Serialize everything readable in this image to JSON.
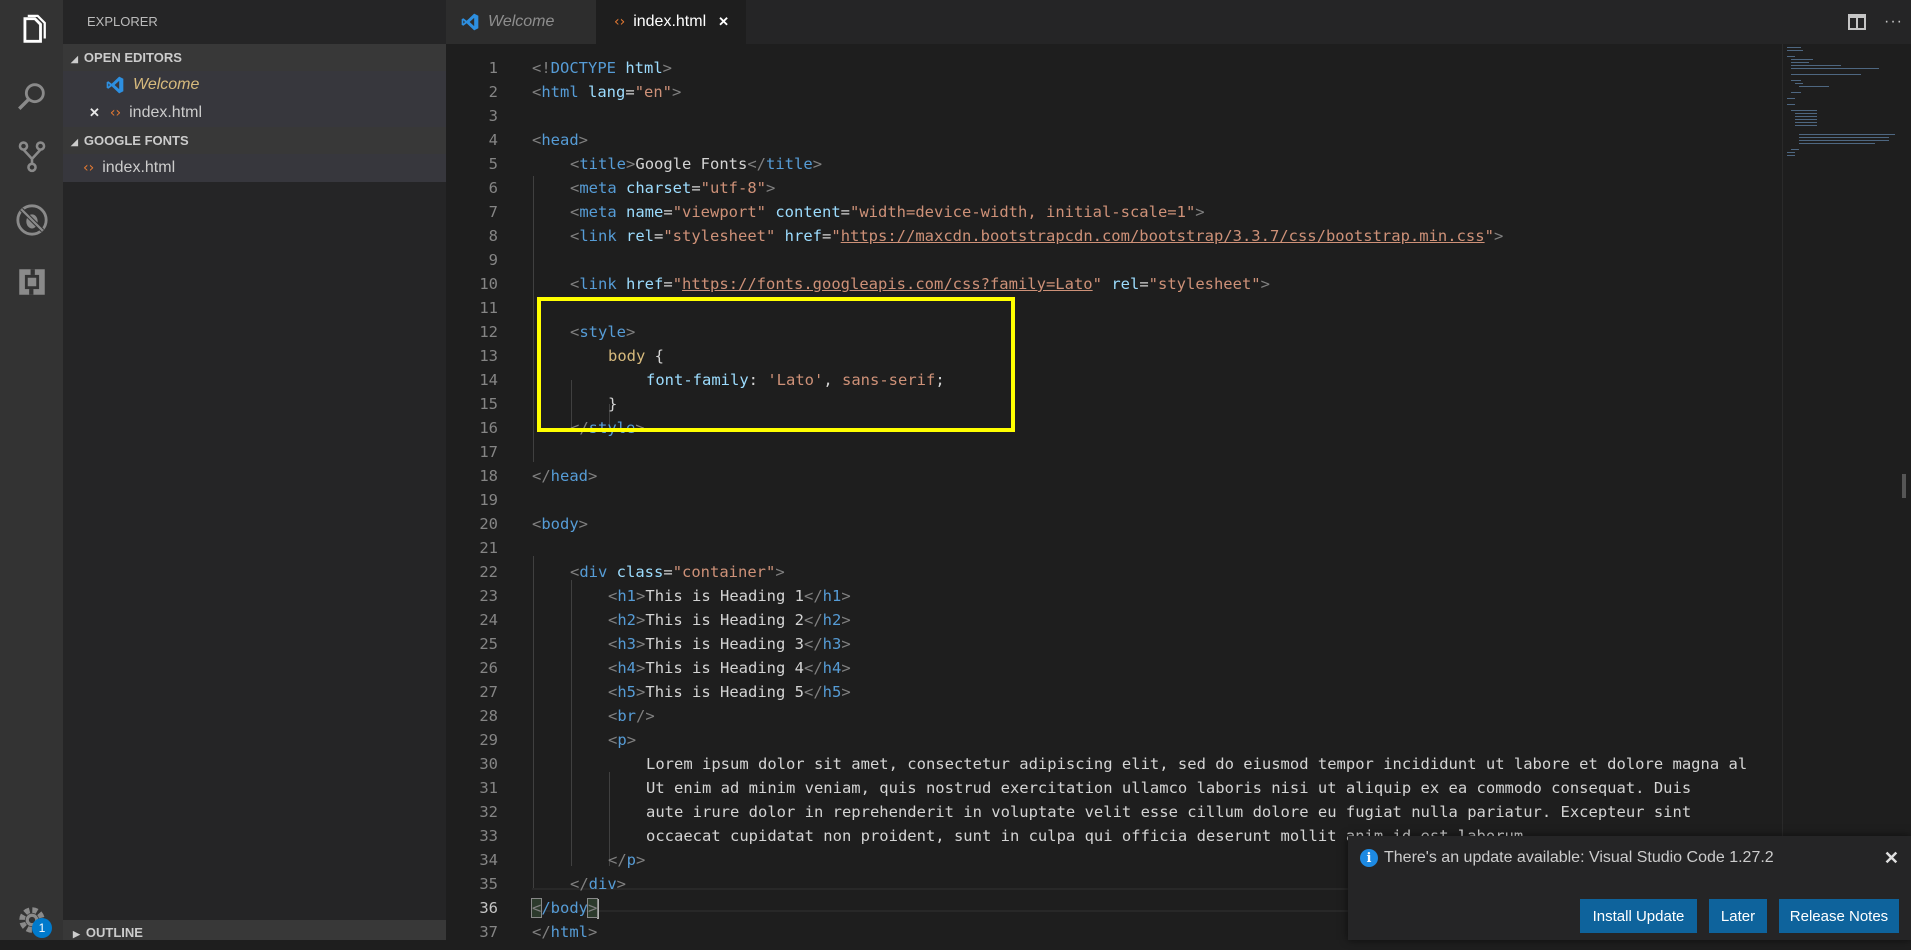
{
  "activity_bar": {
    "items": [
      {
        "name": "explorer",
        "icon": "files-icon"
      },
      {
        "name": "search",
        "icon": "search-icon"
      },
      {
        "name": "source-control",
        "icon": "source-control-icon"
      },
      {
        "name": "debug",
        "icon": "debug-icon"
      },
      {
        "name": "extensions",
        "icon": "extensions-icon"
      }
    ],
    "settings_badge": "1"
  },
  "sidebar": {
    "title": "EXPLORER",
    "sections": [
      {
        "label": "OPEN EDITORS",
        "items": [
          {
            "label": "Welcome",
            "icon": "vscode-icon",
            "italic": true
          },
          {
            "label": "index.html",
            "icon": "html-icon",
            "close": "✕"
          }
        ]
      },
      {
        "label": "GOOGLE FONTS",
        "items": [
          {
            "label": "index.html",
            "icon": "html-icon"
          }
        ]
      }
    ],
    "outline_label": "OUTLINE"
  },
  "tabs": [
    {
      "label": "Welcome",
      "icon": "vscode-icon",
      "active": false
    },
    {
      "label": "index.html",
      "icon": "html-icon",
      "active": true,
      "close": "✕"
    }
  ],
  "tab_actions": {
    "split": "split-editor-icon",
    "more": "···"
  },
  "editor": {
    "current_line": 36,
    "line_numbers": [
      "1",
      "2",
      "3",
      "4",
      "5",
      "6",
      "7",
      "8",
      "9",
      "10",
      "11",
      "12",
      "13",
      "14",
      "15",
      "16",
      "17",
      "18",
      "19",
      "20",
      "21",
      "22",
      "23",
      "24",
      "25",
      "26",
      "27",
      "28",
      "29",
      "30",
      "31",
      "32",
      "33",
      "34",
      "35",
      "36",
      "37"
    ],
    "lines": {
      "l1": {
        "a": "<!",
        "b": "DOCTYPE",
        "c": " html",
        "d": ">"
      },
      "l2": {
        "a": "<",
        "b": "html",
        "c": " lang",
        "d": "=",
        "e": "\"en\"",
        "f": ">"
      },
      "l4": {
        "a": "<",
        "b": "head",
        "c": ">"
      },
      "l5": {
        "a": "<",
        "b": "title",
        "c": ">",
        "d": "Google Fonts",
        "e": "</",
        "f": "title",
        "g": ">"
      },
      "l6": {
        "a": "<",
        "b": "meta",
        "c": " charset",
        "d": "=",
        "e": "\"utf-8\"",
        "f": ">"
      },
      "l7": {
        "a": "<",
        "b": "meta",
        "c": " name",
        "d": "=",
        "e": "\"viewport\"",
        "f": " content",
        "g": "=",
        "h": "\"width=device-width, initial-scale=1\"",
        "i": ">"
      },
      "l8": {
        "a": "<",
        "b": "link",
        "c": " rel",
        "d": "=",
        "e": "\"stylesheet\"",
        "f": " href",
        "g": "=",
        "h": "\"",
        "i": "https://maxcdn.bootstrapcdn.com/bootstrap/3.3.7/css/bootstrap.min.css",
        "j": "\"",
        "k": ">"
      },
      "l10": {
        "a": "<",
        "b": "link",
        "c": " href",
        "d": "=",
        "e": "\"",
        "f": "https://fonts.googleapis.com/css?family=Lato",
        "g": "\"",
        "h": " rel",
        "i": "=",
        "j": "\"stylesheet\"",
        "k": ">"
      },
      "l12": {
        "a": "<",
        "b": "style",
        "c": ">"
      },
      "l13": {
        "a": "body",
        "b": " {"
      },
      "l14": {
        "a": "font-family",
        "b": ": ",
        "c": "'Lato'",
        "d": ", ",
        "e": "sans-serif",
        "f": ";"
      },
      "l15": {
        "a": "}"
      },
      "l16": {
        "a": "</",
        "b": "style",
        "c": ">"
      },
      "l18": {
        "a": "</",
        "b": "head",
        "c": ">"
      },
      "l20": {
        "a": "<",
        "b": "body",
        "c": ">"
      },
      "l22": {
        "a": "<",
        "b": "div",
        "c": " class",
        "d": "=",
        "e": "\"container\"",
        "f": ">"
      },
      "l23": {
        "a": "<",
        "b": "h1",
        "c": ">",
        "d": "This is Heading 1",
        "e": "</",
        "f": "h1",
        "g": ">"
      },
      "l24": {
        "a": "<",
        "b": "h2",
        "c": ">",
        "d": "This is Heading 2",
        "e": "</",
        "f": "h2",
        "g": ">"
      },
      "l25": {
        "a": "<",
        "b": "h3",
        "c": ">",
        "d": "This is Heading 3",
        "e": "</",
        "f": "h3",
        "g": ">"
      },
      "l26": {
        "a": "<",
        "b": "h4",
        "c": ">",
        "d": "This is Heading 4",
        "e": "</",
        "f": "h4",
        "g": ">"
      },
      "l27": {
        "a": "<",
        "b": "h5",
        "c": ">",
        "d": "This is Heading 5",
        "e": "</",
        "f": "h5",
        "g": ">"
      },
      "l28": {
        "a": "<",
        "b": "br",
        "c": "/>"
      },
      "l29": {
        "a": "<",
        "b": "p",
        "c": ">"
      },
      "l30": "Lorem ipsum dolor sit amet, consectetur adipiscing elit, sed do eiusmod tempor incididunt ut labore et dolore magna al",
      "l31": "Ut enim ad minim veniam, quis nostrud exercitation ullamco laboris nisi ut aliquip ex ea commodo consequat. Duis",
      "l32": "aute irure dolor in reprehenderit in voluptate velit esse cillum dolore eu fugiat nulla pariatur. Excepteur sint",
      "l33": "occaecat cupidatat non proident, sunt in culpa qui officia deserunt mollit anim id est laborum..",
      "l34": {
        "a": "</",
        "b": "p",
        "c": ">"
      },
      "l35": {
        "a": "</",
        "b": "div",
        "c": ">"
      },
      "l36": {
        "a": "<",
        "b": "/body",
        "c": ">"
      },
      "l37": {
        "a": "</",
        "b": "html",
        "c": ">"
      }
    },
    "highlight_color": "#ffff00"
  },
  "notification": {
    "message": "There's an update available: Visual Studio Code 1.27.2",
    "icon": "info-icon",
    "close": "✕",
    "buttons": [
      "Install Update",
      "Later",
      "Release Notes"
    ]
  },
  "colors": {
    "accent": "#007acc",
    "button": "#0e639c",
    "highlight": "#ffff00",
    "html_icon": "#e37933"
  }
}
